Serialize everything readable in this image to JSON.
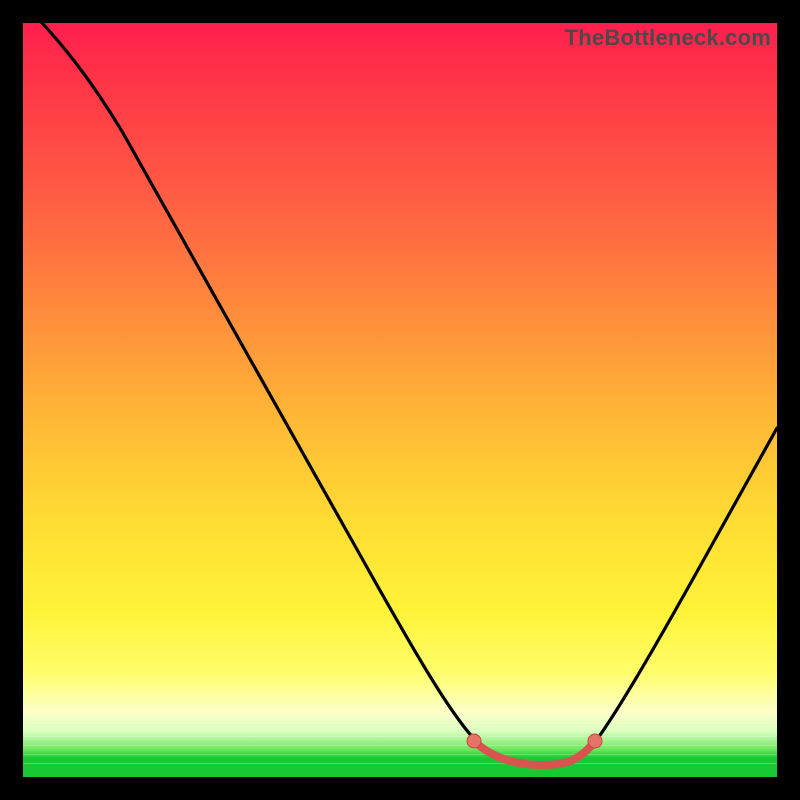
{
  "watermark": "TheBottleneck.com",
  "chart_data": {
    "type": "line",
    "title": "",
    "xlabel": "",
    "ylabel": "",
    "xlim": [
      0,
      100
    ],
    "ylim": [
      0,
      100
    ],
    "x": [
      0,
      3,
      10,
      20,
      30,
      40,
      50,
      55,
      58,
      60,
      62,
      65,
      68,
      71,
      73,
      75,
      78,
      82,
      88,
      94,
      100
    ],
    "values": [
      103,
      100,
      87,
      71,
      55,
      39,
      23,
      15,
      11,
      8,
      5,
      3,
      2,
      2,
      2,
      3,
      6,
      12,
      22,
      34,
      46
    ],
    "minimum_region_x": [
      60,
      76
    ],
    "minimum_value": 2,
    "note": "Values are percent of plot height from bottom; read off the rendered curve. 0 = bottom (green), 100 = top (red)."
  },
  "colors": {
    "frame": "#000000",
    "curve": "#000000",
    "highlight_stroke": "#d9534f",
    "highlight_fill": "#e57368",
    "gradient_top": "#ff1f4f",
    "gradient_mid": "#ffdc33",
    "gradient_bottom": "#18c933"
  }
}
